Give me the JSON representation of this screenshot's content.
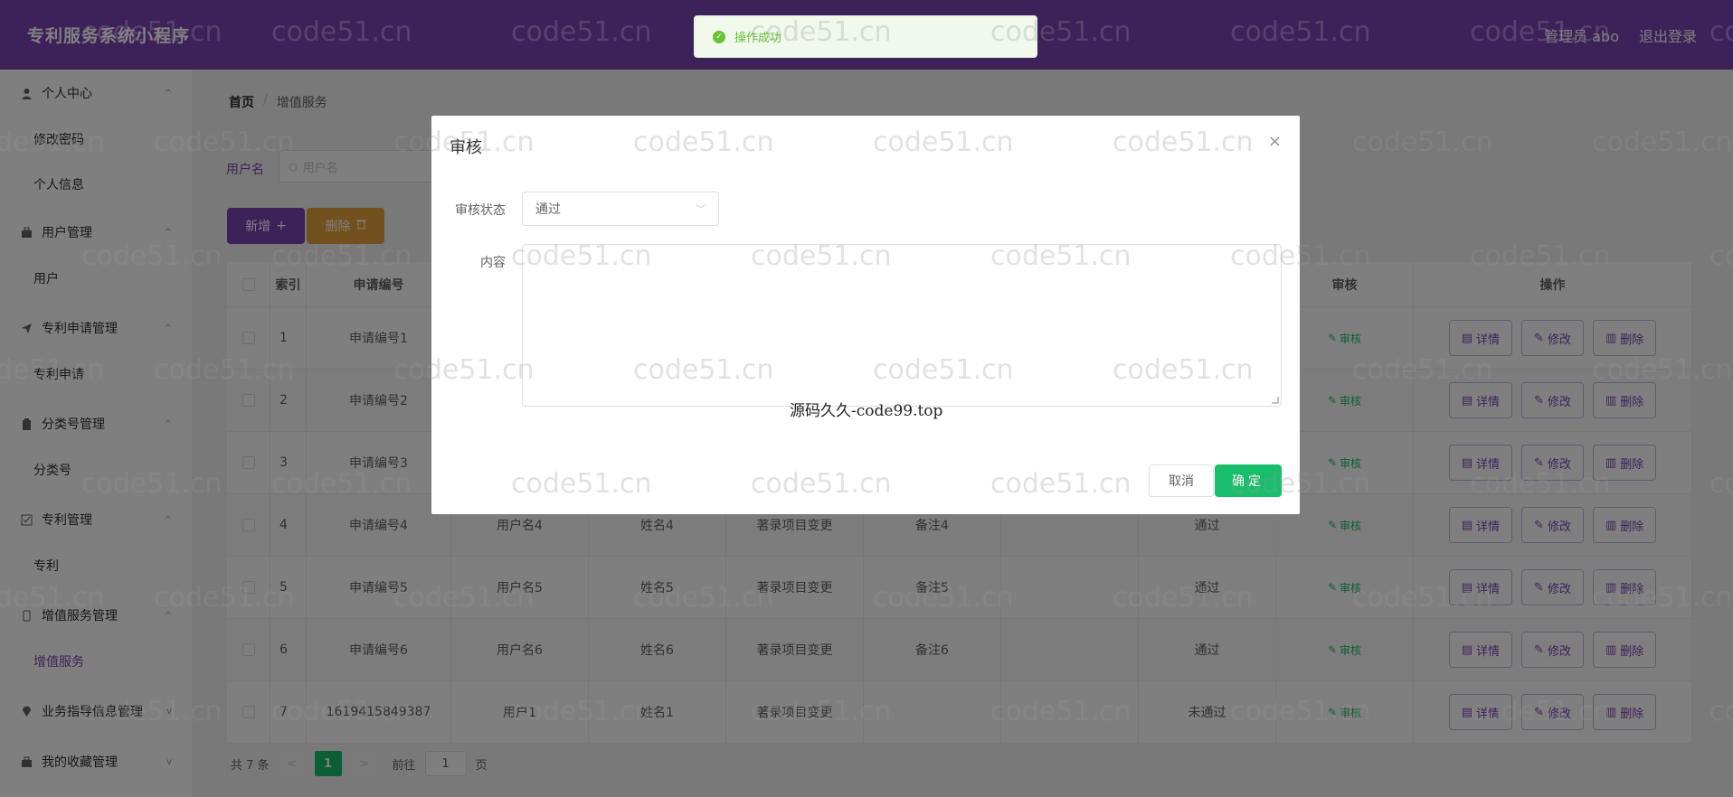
{
  "header": {
    "app_title": "专利服务系统小程序",
    "admin_label": "管理员 abo",
    "logout_label": "退出登录"
  },
  "sidebar": {
    "groups": [
      {
        "title": "个人中心",
        "items": [
          "修改密码",
          "个人信息"
        ]
      },
      {
        "title": "用户管理",
        "items": [
          "用户"
        ]
      },
      {
        "title": "专利申请管理",
        "items": [
          "专利申请"
        ]
      },
      {
        "title": "分类号管理",
        "items": [
          "分类号"
        ]
      },
      {
        "title": "专利管理",
        "items": [
          "专利"
        ]
      },
      {
        "title": "增值服务管理",
        "items": [
          "增值服务"
        ]
      },
      {
        "title": "业务指导信息管理",
        "items": []
      },
      {
        "title": "我的收藏管理",
        "items": []
      }
    ],
    "active_item": "增值服务"
  },
  "breadcrumb": {
    "home": "首页",
    "sep": "/",
    "current": "增值服务"
  },
  "search": {
    "label": "用户名",
    "placeholder": "用户名"
  },
  "toolbar": {
    "add_label": "新增",
    "delete_label": "删除"
  },
  "table": {
    "headers": [
      "索引",
      "申请编号",
      "审核",
      "操作"
    ],
    "rows": [
      {
        "idx": "1",
        "app_no": "申请编号1",
        "username": "",
        "name": "",
        "item": "",
        "note": "",
        "status": ""
      },
      {
        "idx": "2",
        "app_no": "申请编号2",
        "username": "",
        "name": "",
        "item": "",
        "note": "",
        "status": ""
      },
      {
        "idx": "3",
        "app_no": "申请编号3",
        "username": "",
        "name": "",
        "item": "",
        "note": "",
        "status": ""
      },
      {
        "idx": "4",
        "app_no": "申请编号4",
        "username": "用户名4",
        "name": "姓名4",
        "item": "著录项目变更",
        "note": "备注4",
        "status": "通过"
      },
      {
        "idx": "5",
        "app_no": "申请编号5",
        "username": "用户名5",
        "name": "姓名5",
        "item": "著录项目变更",
        "note": "备注5",
        "status": "通过"
      },
      {
        "idx": "6",
        "app_no": "申请编号6",
        "username": "用户名6",
        "name": "姓名6",
        "item": "著录项目变更",
        "note": "备注6",
        "status": "通过"
      },
      {
        "idx": "7",
        "app_no": "1619415849387",
        "username": "用户1",
        "name": "姓名1",
        "item": "著录项目变更",
        "note": "",
        "status": "未通过"
      }
    ],
    "review_label": "审核",
    "op_detail": "详情",
    "op_edit": "修改",
    "op_delete": "删除"
  },
  "pagination": {
    "total": "共 7 条",
    "current_page": "1",
    "goto_label": "前往",
    "goto_value": "1",
    "page_unit": "页"
  },
  "dialog": {
    "title": "审核",
    "status_label": "审核状态",
    "status_value": "通过",
    "content_label": "内容",
    "cancel_label": "取消",
    "ok_label": "确定",
    "watermark_text": "源码久久-code99.top"
  },
  "toast": {
    "message": "操作成功"
  },
  "watermark": {
    "text": "code51.cn"
  },
  "colors": {
    "primary": "#7b45b5",
    "success": "#19be6b",
    "warning": "#e6a23c"
  }
}
